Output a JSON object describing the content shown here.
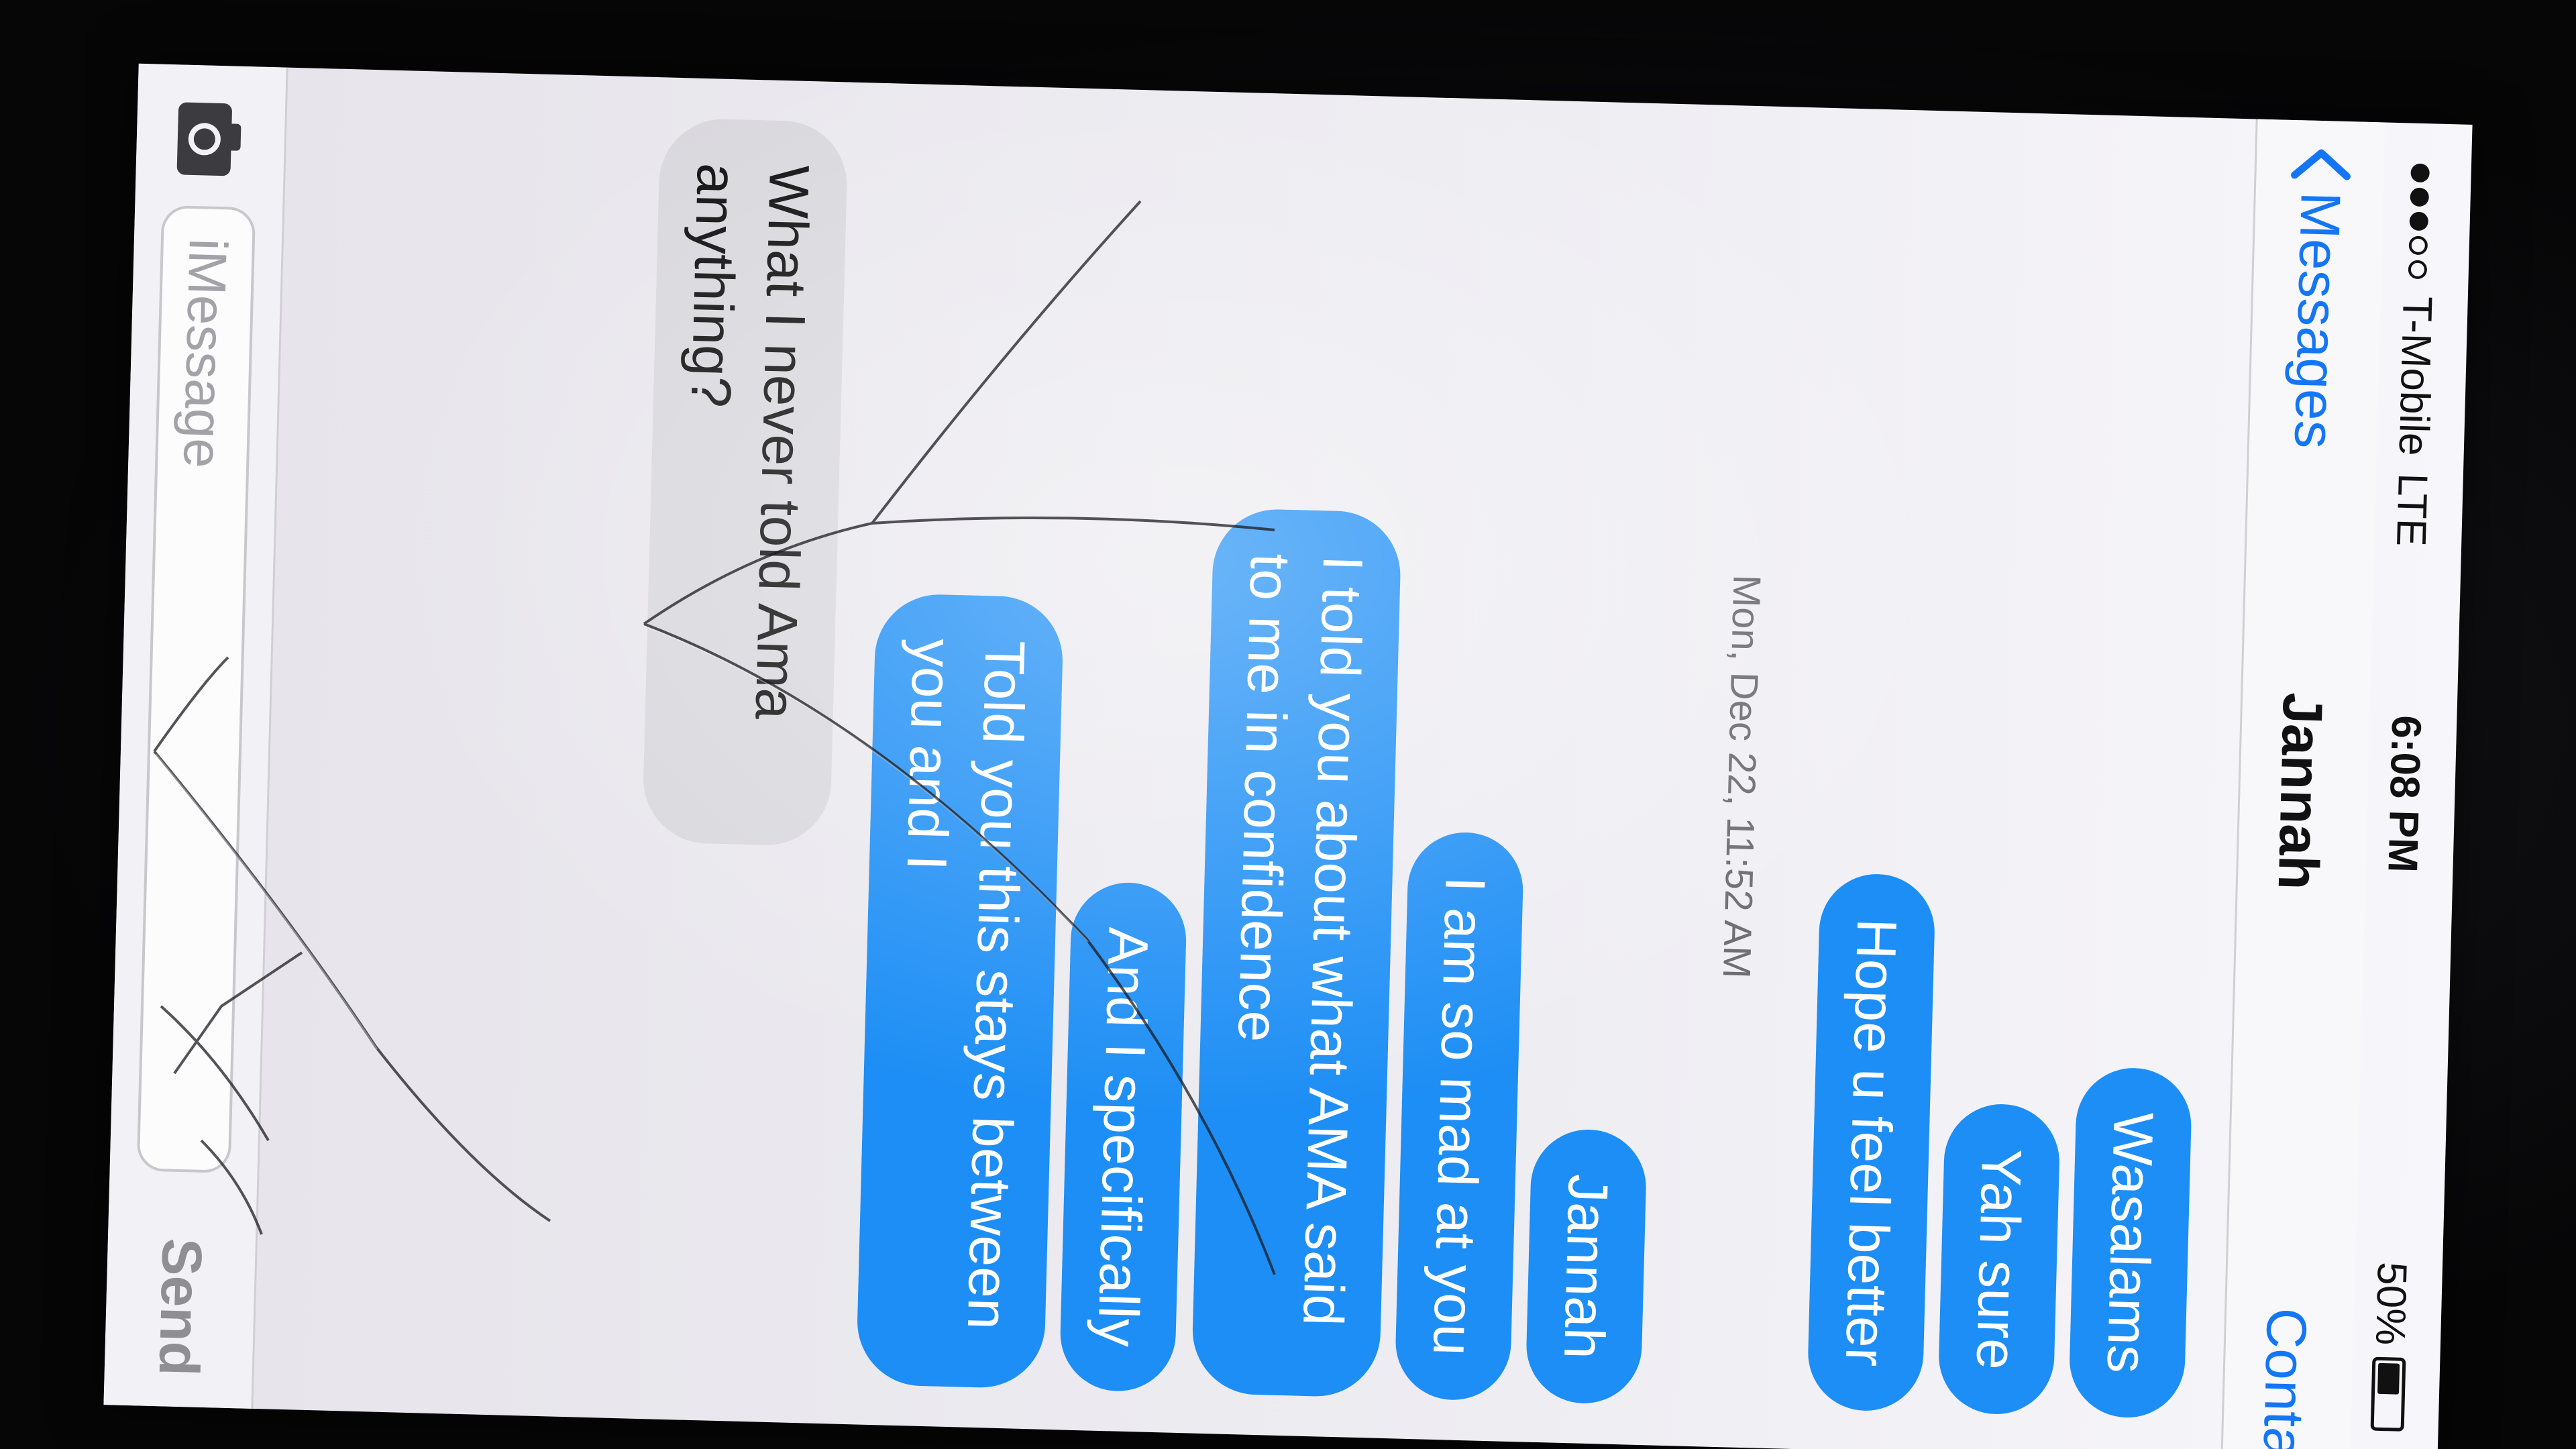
{
  "status_bar": {
    "carrier": "T-Mobile",
    "network": "LTE",
    "time": "6:08 PM",
    "battery": "50%",
    "battery_level": 0.5
  },
  "nav": {
    "back_label": "Messages",
    "title": "Jannah",
    "contact_label": "Contact"
  },
  "thread": {
    "messages": [
      {
        "direction": "out",
        "text": "Wasalams"
      },
      {
        "direction": "out",
        "text": "Yah sure"
      },
      {
        "direction": "out",
        "text": "Hope u feel better"
      },
      {
        "direction": "out",
        "text": "Jannah"
      },
      {
        "direction": "out",
        "text": "I am so mad at you"
      },
      {
        "direction": "out",
        "text": "I told you about what AMA said to me in confidence"
      },
      {
        "direction": "out",
        "text": "And I specifically"
      },
      {
        "direction": "out",
        "text": "Told you this stays between you and I"
      },
      {
        "direction": "in",
        "text": "What I never told Ama anything?"
      }
    ],
    "timestamp": "Mon, Dec 22, 11:52 AM"
  },
  "input_bar": {
    "placeholder": "iMessage",
    "send_label": "Send",
    "camera_icon": "camera-icon"
  },
  "colors": {
    "outgoing_bubble": "#1d8ef5",
    "incoming_bubble": "#d9d8dd",
    "accent": "#1576f5"
  }
}
